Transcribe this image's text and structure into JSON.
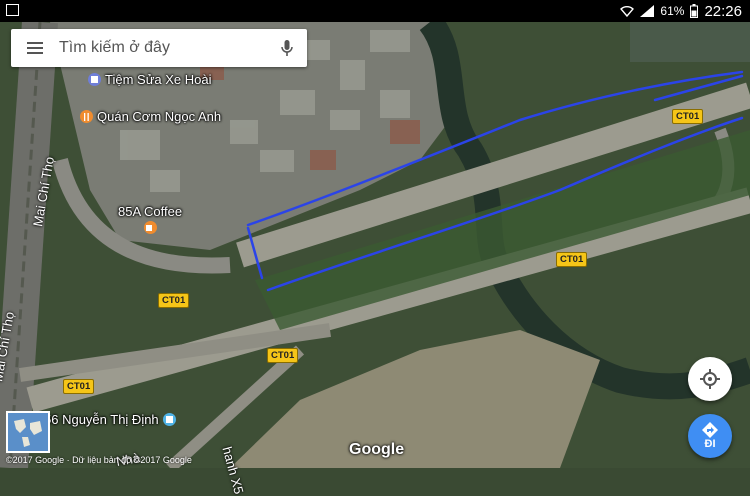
{
  "status_bar": {
    "battery": "61%",
    "time": "22:26",
    "icons": [
      "screenshot-icon",
      "wifi-icon",
      "signal-icon",
      "battery-icon"
    ]
  },
  "search": {
    "placeholder": "Tìm kiếm ở đây",
    "menu_icon": "menu-icon",
    "mic_icon": "mic-icon"
  },
  "pois": [
    {
      "name": "Tiệm Sửa Xe Hoài",
      "icon": "shop-icon",
      "color": "#6f7ed8"
    },
    {
      "name": "Quán Cơm Ngọc Anh",
      "icon": "restaurant-icon",
      "color": "#f08c2e"
    },
    {
      "name": "85A Coffee",
      "icon": "cafe-icon",
      "color": "#f08c2e"
    },
    {
      "name": "56 Nguyễn Thị Định",
      "icon": "store-icon",
      "color": "#4fb3e6"
    }
  ],
  "roads": {
    "highway": "CT01",
    "streets": [
      "Mai Chí Thọ",
      "Nhà",
      "hanh X5"
    ]
  },
  "buttons": {
    "location_icon": "my-location-icon",
    "directions_icon": "directions-icon",
    "directions_label": "ĐI"
  },
  "branding": {
    "logo": "Google",
    "attribution": "©2017 Google · Dữ liệu bản đồ ©2017 Google"
  },
  "colors": {
    "drawn_line": "#2b44e8",
    "highway_shield": "#f5c518",
    "directions_fab": "#3f8ef3"
  }
}
